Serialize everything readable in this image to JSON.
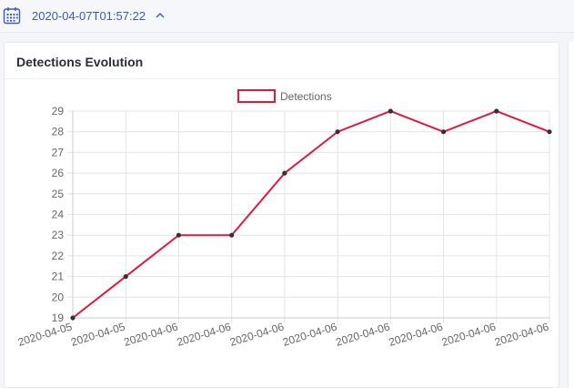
{
  "header": {
    "date_value": "2020-04-07T01:57:22",
    "calendar_icon": "calendar-icon",
    "expand_icon": "chevron-up-icon",
    "accent_color": "#3d57c4"
  },
  "card": {
    "title": "Detections Evolution"
  },
  "chart_data": {
    "type": "line",
    "x": [
      "2020-04-05",
      "2020-04-05",
      "2020-04-06",
      "2020-04-06",
      "2020-04-06",
      "2020-04-06",
      "2020-04-06",
      "2020-04-06",
      "2020-04-06",
      "2020-04-06"
    ],
    "series": [
      {
        "name": "Detections",
        "values": [
          19,
          21,
          23,
          23,
          26,
          28,
          29,
          28,
          29,
          28
        ],
        "color": "#e2183d"
      }
    ],
    "yticks": [
      19,
      20,
      21,
      22,
      23,
      24,
      25,
      26,
      27,
      28,
      29
    ],
    "ylim": [
      19,
      29
    ],
    "grid": true,
    "legend": "top-center"
  }
}
